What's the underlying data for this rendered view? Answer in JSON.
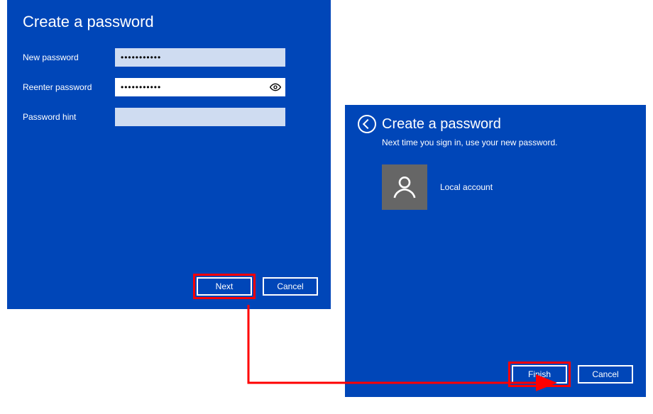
{
  "left": {
    "title": "Create a password",
    "new_password_label": "New password",
    "new_password_value": "•••••••••••",
    "reenter_label": "Reenter password",
    "reenter_value": "•••••••••••",
    "hint_label": "Password hint",
    "hint_value": "",
    "next_label": "Next",
    "cancel_label": "Cancel"
  },
  "right": {
    "title": "Create a password",
    "subtitle": "Next time you sign in, use your new password.",
    "account_label": "Local account",
    "finish_label": "Finish",
    "cancel_label": "Cancel"
  }
}
